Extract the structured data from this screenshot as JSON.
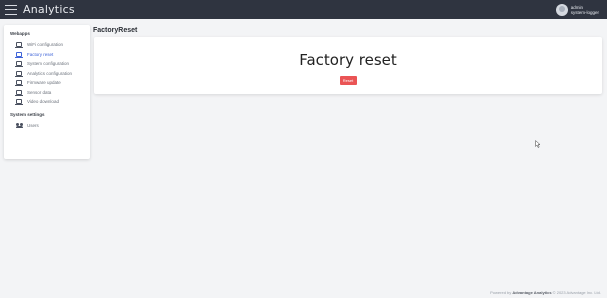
{
  "app": {
    "brand": "Analytics"
  },
  "user": {
    "name": "admin",
    "role": "system-logger"
  },
  "sidebar": {
    "sections": [
      {
        "title": "Webapps",
        "items": [
          {
            "label": "WiFi configuration",
            "icon": "monitor-icon",
            "active": false
          },
          {
            "label": "Factory reset",
            "icon": "monitor-icon",
            "active": true
          },
          {
            "label": "System configuration",
            "icon": "monitor-icon",
            "active": false
          },
          {
            "label": "Analytics configuration",
            "icon": "monitor-icon",
            "active": false
          },
          {
            "label": "Firmware update",
            "icon": "monitor-icon",
            "active": false
          },
          {
            "label": "Sensor data",
            "icon": "monitor-icon",
            "active": false
          },
          {
            "label": "Video download",
            "icon": "monitor-icon",
            "active": false
          }
        ]
      },
      {
        "title": "System settings",
        "items": [
          {
            "label": "Users",
            "icon": "users-icon",
            "active": false
          }
        ]
      }
    ]
  },
  "main": {
    "page_title": "FactoryReset",
    "card_heading": "Factory reset",
    "reset_button_label": "Reset"
  },
  "footer": {
    "prefix": "Powered by ",
    "company": "Advantage Analytics",
    "suffix": " © 2023 Advantage Inc. Ltd."
  },
  "colors": {
    "topbar": "#2f3440",
    "accent": "#3e63d8",
    "danger": "#ea5455",
    "background": "#f3f4f6"
  }
}
